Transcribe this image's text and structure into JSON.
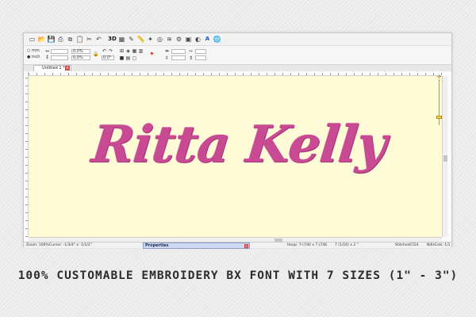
{
  "toolbar": {
    "icons": [
      "new-icon",
      "open-icon",
      "save-icon",
      "print-icon",
      "copy-icon",
      "paste-icon",
      "cut-icon",
      "undo-icon",
      "3d-view-icon",
      "color-icon",
      "stitch-icon",
      "ruler-icon",
      "needle-icon",
      "hoop-icon",
      "thread-icon",
      "settings-icon",
      "frame-icon",
      "text-icon",
      "browser-icon"
    ],
    "label_3d": "3D",
    "label_text": "A"
  },
  "property_bar": {
    "unit_mm": "mm",
    "unit_inch": "inch",
    "scale_x": "0.0%",
    "scale_y": "0.0%",
    "angle": "0.0°"
  },
  "tabs": [
    {
      "label": "Untitled 1 *"
    }
  ],
  "design": {
    "text": "Ritta Kelly",
    "color": "#c84a92"
  },
  "canvas": {
    "background": "#fffbd7"
  },
  "status": {
    "zoom": "Zoom: 100%",
    "cursor": "Cursor: -1/3/4\" x -1/1/2\"",
    "hoop": "Hoop: 7-(7/8) x 7 (7/8)",
    "size": "7 (1/16) x 2 \"",
    "stitches": "Stitches6724",
    "needle": "NdlsCols: 1/1"
  },
  "properties_panel": {
    "title": "Properties"
  },
  "caption": "100% CUSTOMABLE EMBROIDERY BX FONT WITH 7 SIZES (1\" -  3\")"
}
